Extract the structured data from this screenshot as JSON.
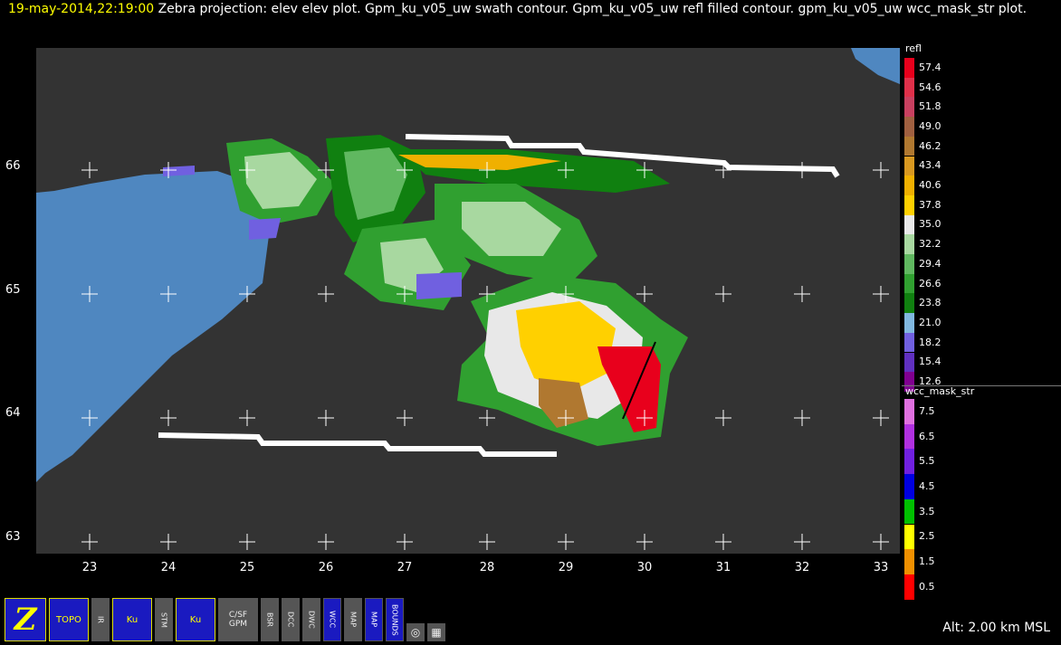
{
  "header": {
    "time": "19-may-2014,22:19:00",
    "description": "Zebra projection: elev elev  plot.  Gpm_ku_v05_uw swath contour.  Gpm_ku_v05_uw refl filled contour.  gpm_ku_v05_uw wcc_mask_str  plot."
  },
  "plot": {
    "y_ticks": [
      "66",
      "65",
      "64",
      "63"
    ],
    "x_ticks": [
      "23",
      "24",
      "25",
      "26",
      "27",
      "28",
      "29",
      "30",
      "31",
      "32",
      "33"
    ]
  },
  "colorbar_refl": {
    "title": "refl",
    "levels": [
      {
        "label": "57.4",
        "color": "#e8001c"
      },
      {
        "label": "54.6",
        "color": "#e0304a"
      },
      {
        "label": "51.8",
        "color": "#c84060"
      },
      {
        "label": "49.0",
        "color": "#a06040"
      },
      {
        "label": "46.2",
        "color": "#b07830"
      },
      {
        "label": "43.4",
        "color": "#d89820"
      },
      {
        "label": "40.6",
        "color": "#f0b000"
      },
      {
        "label": "37.8",
        "color": "#ffd000"
      },
      {
        "label": "35.0",
        "color": "#e8e8e8"
      },
      {
        "label": "32.2",
        "color": "#a8d8a0"
      },
      {
        "label": "29.4",
        "color": "#60b860"
      },
      {
        "label": "26.6",
        "color": "#30a030"
      },
      {
        "label": "23.8",
        "color": "#108010"
      },
      {
        "label": "21.0",
        "color": "#80b8e0"
      },
      {
        "label": "18.2",
        "color": "#7060e0"
      },
      {
        "label": "15.4",
        "color": "#6030c0"
      },
      {
        "label": "12.6",
        "color": "#800090"
      }
    ]
  },
  "colorbar_wcc": {
    "title": "wcc_mask_str",
    "levels": [
      {
        "label": "7.5",
        "color": "#e070e0"
      },
      {
        "label": "6.5",
        "color": "#b030e0"
      },
      {
        "label": "5.5",
        "color": "#7020e0"
      },
      {
        "label": "4.5",
        "color": "#0000e0"
      },
      {
        "label": "3.5",
        "color": "#00c000"
      },
      {
        "label": "2.5",
        "color": "#ffff00"
      },
      {
        "label": "1.5",
        "color": "#f09000"
      },
      {
        "label": "0.5",
        "color": "#ff0000"
      }
    ]
  },
  "toolbar": {
    "buttons": [
      "Z",
      "TOPO",
      "IR",
      "Ku",
      "STM",
      "Ku",
      "C/SF GPM",
      "BSR",
      "DCC",
      "DWC",
      "WCC",
      "MAP",
      "MAP",
      "BOUNDS"
    ]
  },
  "status": {
    "altitude": "Alt: 2.00 km MSL"
  }
}
